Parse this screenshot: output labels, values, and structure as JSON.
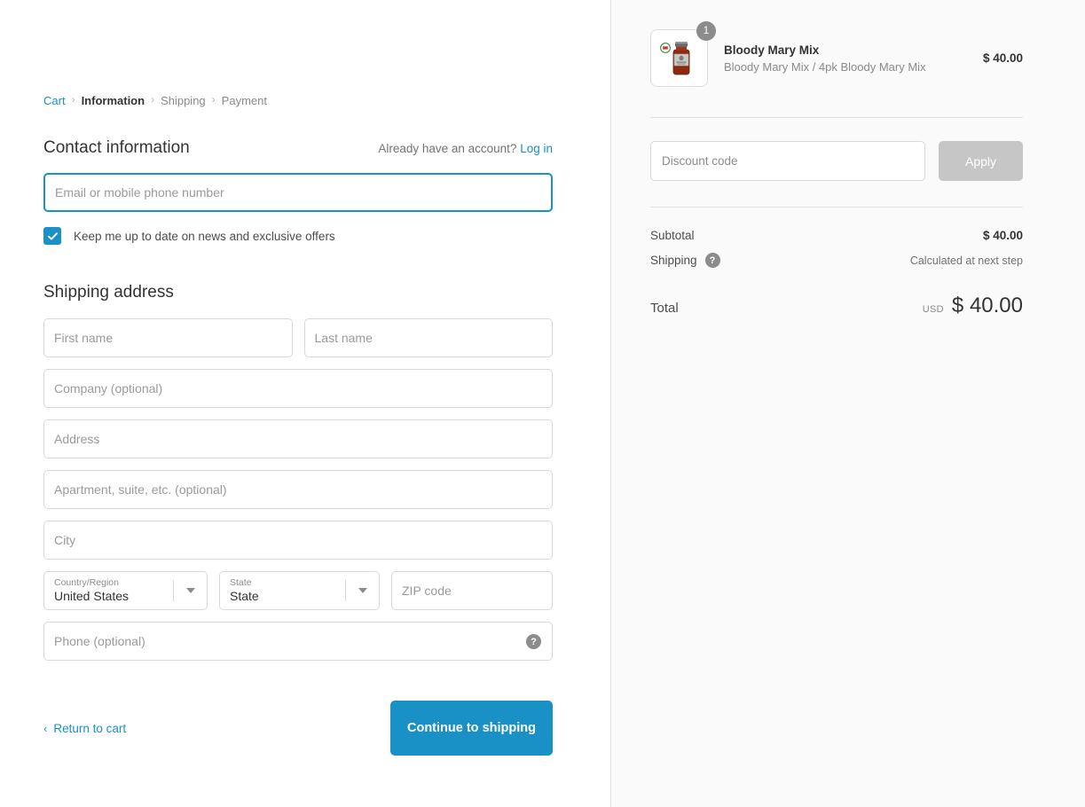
{
  "breadcrumb": {
    "items": [
      {
        "label": "Cart",
        "state": "link"
      },
      {
        "label": "Information",
        "state": "current"
      },
      {
        "label": "Shipping",
        "state": "muted"
      },
      {
        "label": "Payment",
        "state": "muted"
      }
    ],
    "separator": "›"
  },
  "contact": {
    "title": "Contact information",
    "account_prompt": "Already have an account?",
    "login_label": "Log in",
    "email_placeholder": "Email or mobile phone number",
    "email_value": "",
    "newsletter_label": "Keep me up to date on news and exclusive offers",
    "newsletter_checked": true
  },
  "shipping_address": {
    "title": "Shipping address",
    "first_name_placeholder": "First name",
    "last_name_placeholder": "Last name",
    "company_placeholder": "Company (optional)",
    "address_placeholder": "Address",
    "apartment_placeholder": "Apartment, suite, etc. (optional)",
    "city_placeholder": "City",
    "country": {
      "label": "Country/Region",
      "value": "United States"
    },
    "state": {
      "label": "State",
      "value": "State"
    },
    "zip_placeholder": "ZIP code",
    "phone_placeholder": "Phone (optional)",
    "phone_help_icon": "question-mark"
  },
  "actions": {
    "return_to_cart": "Return to cart",
    "return_chevron": "‹",
    "continue": "Continue to shipping"
  },
  "order_summary": {
    "item": {
      "title": "Bloody Mary Mix",
      "variant": "Bloody Mary Mix / 4pk Bloody Mary Mix",
      "price": "$ 40.00",
      "quantity": "1",
      "image_alt": "bloody-mary-mix-jar"
    },
    "discount": {
      "placeholder": "Discount code",
      "value": "",
      "apply_label": "Apply"
    },
    "subtotal": {
      "label": "Subtotal",
      "value": "$ 40.00"
    },
    "shipping": {
      "label": "Shipping",
      "value": "Calculated at next step",
      "help_icon": "question-mark"
    },
    "total": {
      "label": "Total",
      "currency": "USD",
      "value": "$ 40.00"
    }
  },
  "colors": {
    "accent": "#1990c6",
    "sidebar_bg": "#fafafa",
    "border": "#d9d9d9",
    "muted_text": "#8a8a8a",
    "disabled_button": "#c6c6c6"
  }
}
